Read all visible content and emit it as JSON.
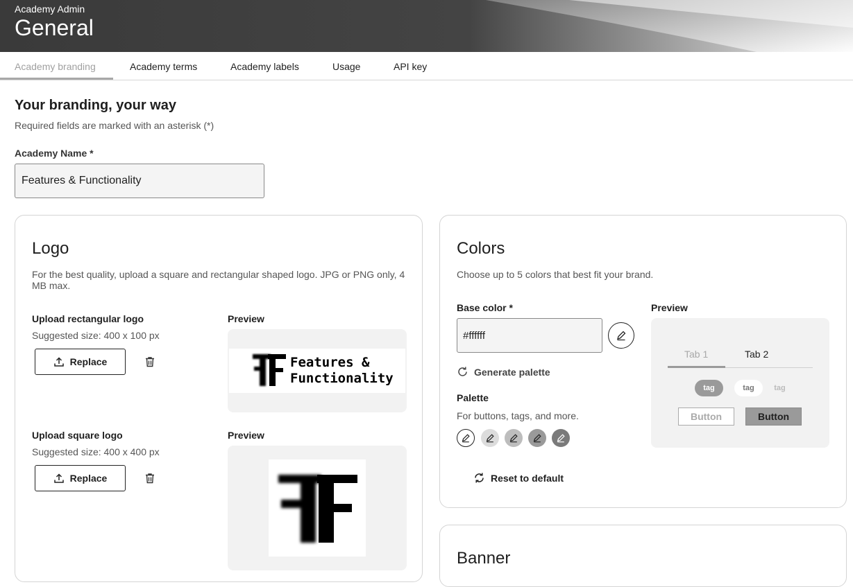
{
  "header": {
    "subtitle": "Academy Admin",
    "title": "General"
  },
  "tabs": [
    {
      "label": "Academy branding",
      "active": true
    },
    {
      "label": "Academy terms"
    },
    {
      "label": "Academy labels"
    },
    {
      "label": "Usage"
    },
    {
      "label": "API key"
    }
  ],
  "intro": {
    "heading": "Your branding, your way",
    "required_note": "Required fields are marked with an asterisk (*)"
  },
  "academy_name": {
    "label": "Academy Name *",
    "value": "Features & Functionality"
  },
  "logo": {
    "title": "Logo",
    "description": "For the best quality, upload a square and rectangular shaped logo. JPG or PNG only, 4 MB max.",
    "rect": {
      "label": "Upload rectangular logo",
      "hint": "Suggested size: 400 x 100 px",
      "button": "Replace",
      "preview_label": "Preview",
      "logo_line1": "Features &",
      "logo_line2": "Functionality"
    },
    "square": {
      "label": "Upload square logo",
      "hint": "Suggested size: 400 x 400 px",
      "button": "Replace",
      "preview_label": "Preview"
    }
  },
  "colors": {
    "title": "Colors",
    "description": "Choose up to 5 colors that best fit your brand.",
    "base_label": "Base color *",
    "base_value": "#ffffff",
    "generate": "Generate palette",
    "palette_label": "Palette",
    "palette_desc": "For buttons, tags, and more.",
    "palette": [
      "#ffffff",
      "#dcdcdc",
      "#bdbdbd",
      "#9a9a9a",
      "#7a7a7a"
    ],
    "reset": "Reset to default",
    "preview_label": "Preview",
    "preview": {
      "tab1": "Tab 1",
      "tab2": "Tab 2",
      "tag1": "tag",
      "tag2": "tag",
      "tag3": "tag",
      "btn1": "Button",
      "btn2": "Button"
    }
  },
  "banner": {
    "title": "Banner"
  }
}
